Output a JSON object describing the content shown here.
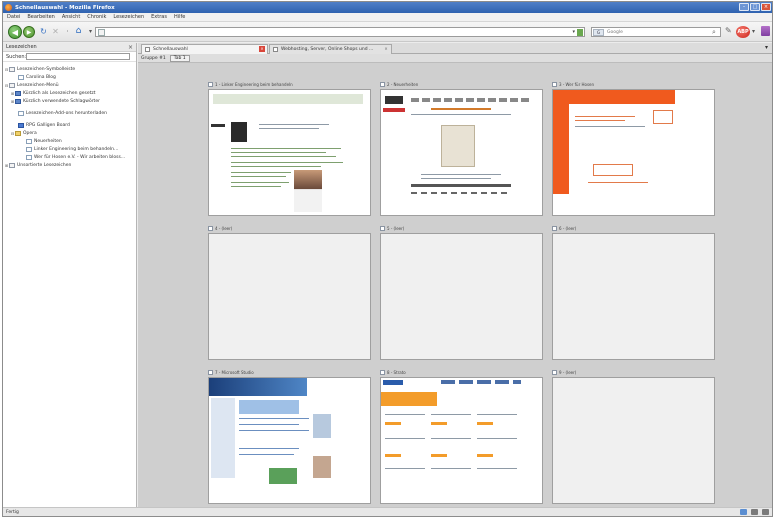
{
  "window": {
    "title": "Schnellauswahl - Mozilla Firefox"
  },
  "menubar": [
    "Datei",
    "Bearbeiten",
    "Ansicht",
    "Chronik",
    "Lesezeichen",
    "Extras",
    "Hilfe"
  ],
  "search": {
    "placeholder": "Google"
  },
  "sidebar": {
    "title": "Lesezeichen",
    "search_label": "Suchen:",
    "items": [
      {
        "label": "Lesezeichen-Symbolleiste"
      },
      {
        "label": "Carolina Blog"
      },
      {
        "label": "Lesezeichen-Menü"
      },
      {
        "label": "Kürzlich als Lesezeichen gesetzt"
      },
      {
        "label": "Kürzlich verwendete Schlagwörter"
      },
      {
        "label": "Lesezeichen-Add-ons herunterladen"
      },
      {
        "label": "RPG Galligen Board"
      },
      {
        "label": "Opera"
      },
      {
        "label": "Neuerheiten"
      },
      {
        "label": "Linker Engineering beim behandeln..."
      },
      {
        "label": "Wer für Hosen e.V. - Wir arbeiten bloss..."
      },
      {
        "label": "Unsortierte Lesezeichen"
      }
    ]
  },
  "tabs": [
    {
      "label": "Schnellauswahl"
    },
    {
      "label": "Webhosting, Server, Online Shops und ..."
    }
  ],
  "groupbar": {
    "label": "Gruppe #1",
    "tab": "Tab 1"
  },
  "thumbnails": [
    {
      "label": "1 - Linker Engineering beim behandeln"
    },
    {
      "label": "2 - Neuerheiten"
    },
    {
      "label": "3 - Wer für Hosen"
    },
    {
      "label": "4 - (leer)"
    },
    {
      "label": "5 - (leer)"
    },
    {
      "label": "6 - (leer)"
    },
    {
      "label": "7 - Microsoft Studio"
    },
    {
      "label": "8 - Strato"
    },
    {
      "label": "9 - (leer)"
    }
  ],
  "status": {
    "text": "Fertig"
  },
  "icons": {
    "back": "back-arrow-icon",
    "forward": "forward-arrow-icon",
    "reload": "reload-icon",
    "stop": "stop-icon",
    "home": "home-icon",
    "adblock": "adblock-icon"
  },
  "colors": {
    "titlebar": "#2f62b0",
    "accent_orange": "#f05a1e",
    "adblock_red": "#c9221a"
  }
}
